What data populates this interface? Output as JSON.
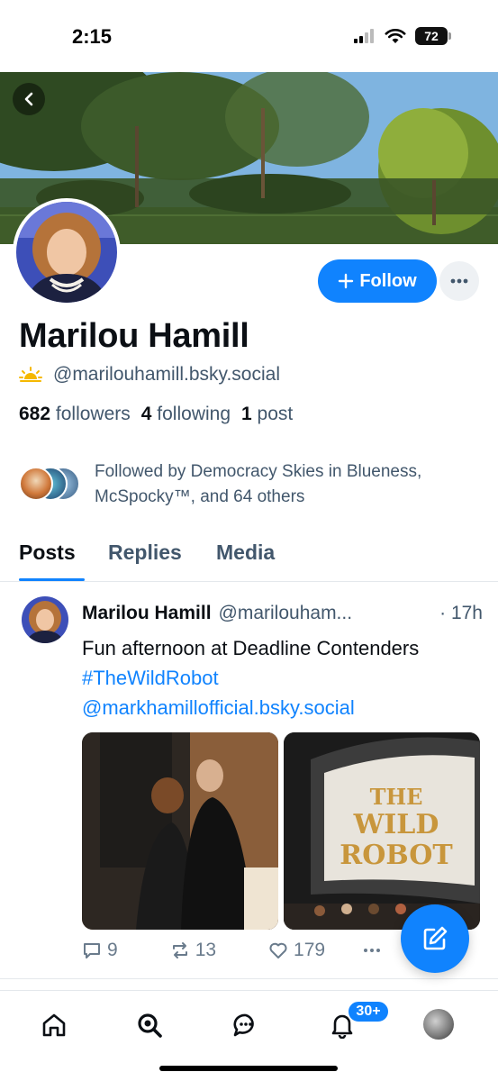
{
  "status_bar": {
    "time": "2:15",
    "battery": "72"
  },
  "profile": {
    "display_name": "Marilou Hamill",
    "handle": "@marilouhamill.bsky.social",
    "stats": {
      "followers_count": "682",
      "followers_label": "followers",
      "following_count": "4",
      "following_label": "following",
      "posts_count": "1",
      "posts_label": "post"
    },
    "follow_label": "Follow",
    "followed_by": "Followed by Democracy Skies in Blueness, McSpocky™, and 64 others"
  },
  "tabs": [
    {
      "label": "Posts",
      "active": true
    },
    {
      "label": "Replies",
      "active": false
    },
    {
      "label": "Media",
      "active": false
    }
  ],
  "post": {
    "author": "Marilou Hamill",
    "handle": "@marilouham...",
    "time": "· 17h",
    "text_plain": "Fun afternoon at Deadline Contenders ",
    "hashtag": "#TheWildRobot",
    "mention": "@markhamillofficial.bsky.social",
    "image2_text": "THE WILD ROBOT",
    "actions": {
      "replies": "9",
      "reposts": "13",
      "likes": "179"
    }
  },
  "nav": {
    "notification_badge": "30+"
  },
  "colors": {
    "accent": "#1083fe",
    "text": "#0b0f14",
    "muted": "#42576c"
  }
}
